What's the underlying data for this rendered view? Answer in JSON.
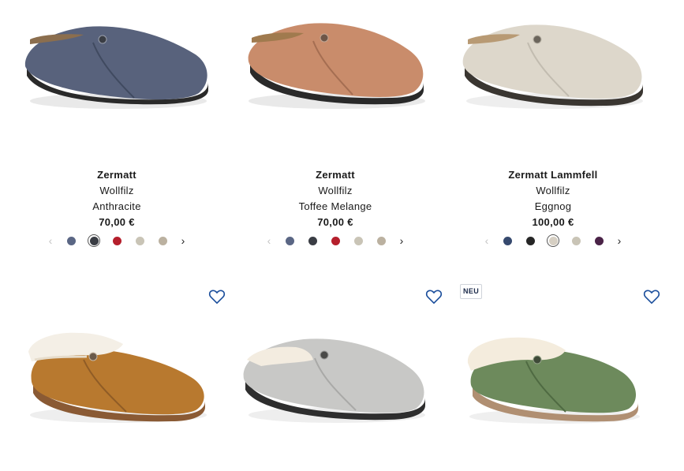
{
  "products_row1": [
    {
      "name": "Zermatt",
      "material": "Wollfilz",
      "color": "Anthracite",
      "price": "70,00 €",
      "felt": "#56607a",
      "swatches": [
        "#5a6684",
        "#3a3d44",
        "#b51f2c",
        "#c9c4b6",
        "#bbb1a0"
      ],
      "active_swatch": 1
    },
    {
      "name": "Zermatt",
      "material": "Wollfilz",
      "color": "Toffee Melange",
      "price": "70,00 €",
      "felt": "#c98c6b",
      "swatches": [
        "#5a6684",
        "#3a3d44",
        "#b51f2c",
        "#c9c4b6",
        "#bbb1a0"
      ],
      "active_swatch": -1
    },
    {
      "name": "Zermatt Lammfell",
      "material": "Wollfilz",
      "color": "Eggnog",
      "price": "100,00 €",
      "felt": "#ddd7cb",
      "swatches": [
        "#36496e",
        "#262626",
        "#d6cfc3",
        "#c9c4b6",
        "#4a2347"
      ],
      "active_swatch": 2
    }
  ],
  "products_row2": [
    {
      "felt": "#b8792f",
      "fur": true,
      "badge": ""
    },
    {
      "felt": "#c8c8c6",
      "fur": true,
      "badge": ""
    },
    {
      "felt": "#6d8a5c",
      "fur": true,
      "badge": "NEU"
    }
  ],
  "icons": {
    "wishlist": "heart-outline-icon",
    "prev": "chevron-left-icon",
    "next": "chevron-right-icon"
  },
  "nav": {
    "prev_glyph": "‹",
    "next_glyph": "›"
  },
  "accent_color": "#1c4f9c"
}
